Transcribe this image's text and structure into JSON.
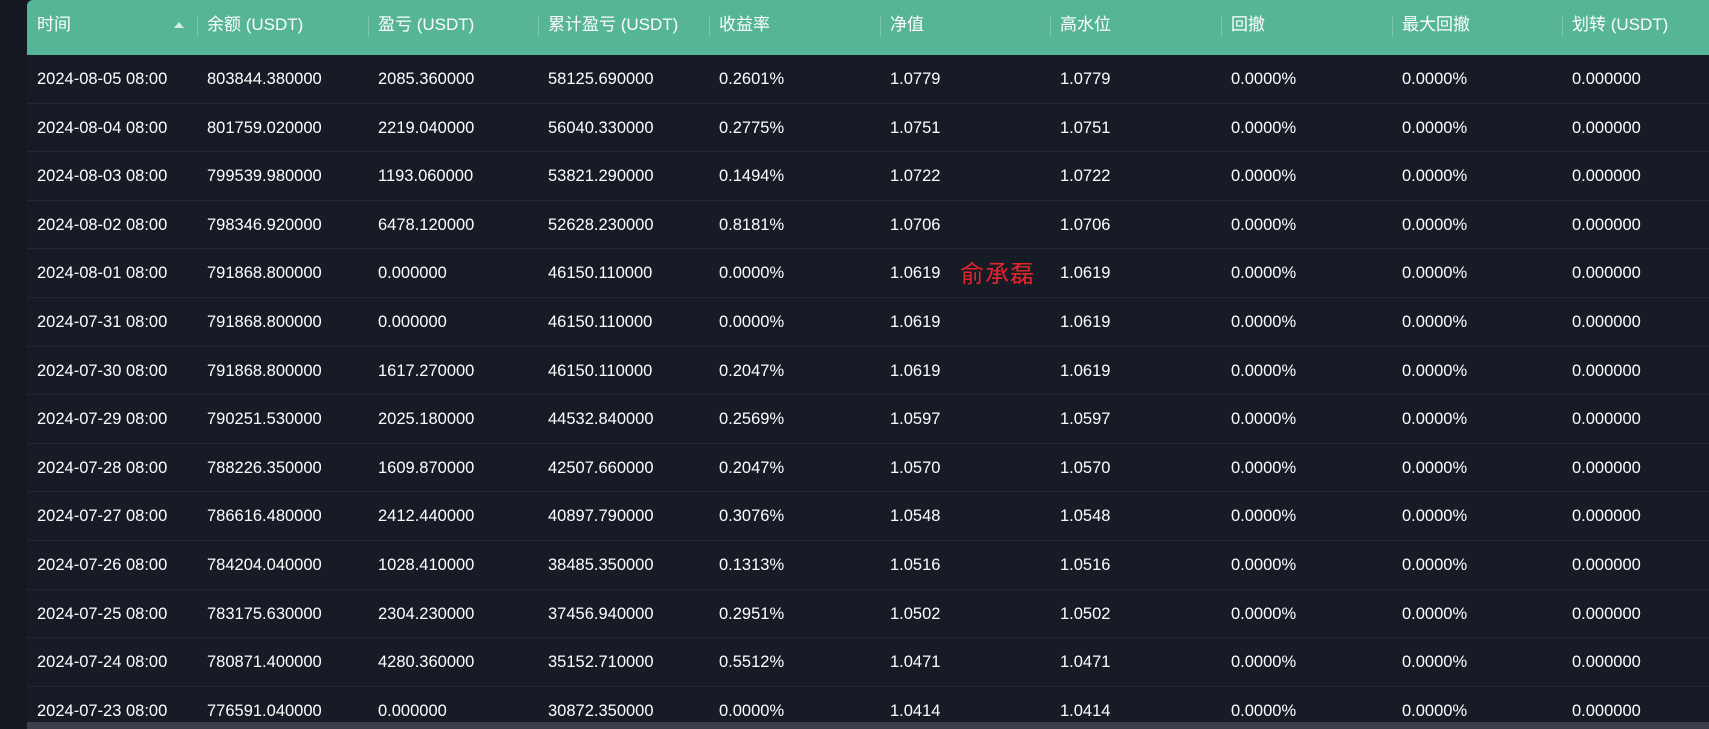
{
  "colors": {
    "header_bg": "#55b596",
    "table_bg": "#171b26",
    "row_text": "#ffffff",
    "watermark": "#e3262b"
  },
  "table": {
    "columns": [
      "时间",
      "余额 (USDT)",
      "盈亏 (USDT)",
      "累计盈亏 (USDT)",
      "收益率",
      "净值",
      "高水位",
      "回撤",
      "最大回撤",
      "划转 (USDT)"
    ],
    "sort_icon": "sort-ascending-icon",
    "rows": [
      [
        "2024-08-05 08:00",
        "803844.380000",
        "2085.360000",
        "58125.690000",
        "0.2601%",
        "1.0779",
        "1.0779",
        "0.0000%",
        "0.0000%",
        "0.000000"
      ],
      [
        "2024-08-04 08:00",
        "801759.020000",
        "2219.040000",
        "56040.330000",
        "0.2775%",
        "1.0751",
        "1.0751",
        "0.0000%",
        "0.0000%",
        "0.000000"
      ],
      [
        "2024-08-03 08:00",
        "799539.980000",
        "1193.060000",
        "53821.290000",
        "0.1494%",
        "1.0722",
        "1.0722",
        "0.0000%",
        "0.0000%",
        "0.000000"
      ],
      [
        "2024-08-02 08:00",
        "798346.920000",
        "6478.120000",
        "52628.230000",
        "0.8181%",
        "1.0706",
        "1.0706",
        "0.0000%",
        "0.0000%",
        "0.000000"
      ],
      [
        "2024-08-01 08:00",
        "791868.800000",
        "0.000000",
        "46150.110000",
        "0.0000%",
        "1.0619",
        "1.0619",
        "0.0000%",
        "0.0000%",
        "0.000000"
      ],
      [
        "2024-07-31 08:00",
        "791868.800000",
        "0.000000",
        "46150.110000",
        "0.0000%",
        "1.0619",
        "1.0619",
        "0.0000%",
        "0.0000%",
        "0.000000"
      ],
      [
        "2024-07-30 08:00",
        "791868.800000",
        "1617.270000",
        "46150.110000",
        "0.2047%",
        "1.0619",
        "1.0619",
        "0.0000%",
        "0.0000%",
        "0.000000"
      ],
      [
        "2024-07-29 08:00",
        "790251.530000",
        "2025.180000",
        "44532.840000",
        "0.2569%",
        "1.0597",
        "1.0597",
        "0.0000%",
        "0.0000%",
        "0.000000"
      ],
      [
        "2024-07-28 08:00",
        "788226.350000",
        "1609.870000",
        "42507.660000",
        "0.2047%",
        "1.0570",
        "1.0570",
        "0.0000%",
        "0.0000%",
        "0.000000"
      ],
      [
        "2024-07-27 08:00",
        "786616.480000",
        "2412.440000",
        "40897.790000",
        "0.3076%",
        "1.0548",
        "1.0548",
        "0.0000%",
        "0.0000%",
        "0.000000"
      ],
      [
        "2024-07-26 08:00",
        "784204.040000",
        "1028.410000",
        "38485.350000",
        "0.1313%",
        "1.0516",
        "1.0516",
        "0.0000%",
        "0.0000%",
        "0.000000"
      ],
      [
        "2024-07-25 08:00",
        "783175.630000",
        "2304.230000",
        "37456.940000",
        "0.2951%",
        "1.0502",
        "1.0502",
        "0.0000%",
        "0.0000%",
        "0.000000"
      ],
      [
        "2024-07-24 08:00",
        "780871.400000",
        "4280.360000",
        "35152.710000",
        "0.5512%",
        "1.0471",
        "1.0471",
        "0.0000%",
        "0.0000%",
        "0.000000"
      ],
      [
        "2024-07-23 08:00",
        "776591.040000",
        "0.000000",
        "30872.350000",
        "0.0000%",
        "1.0414",
        "1.0414",
        "0.0000%",
        "0.0000%",
        "0.000000"
      ]
    ]
  },
  "watermark": {
    "text": "俞承磊"
  }
}
